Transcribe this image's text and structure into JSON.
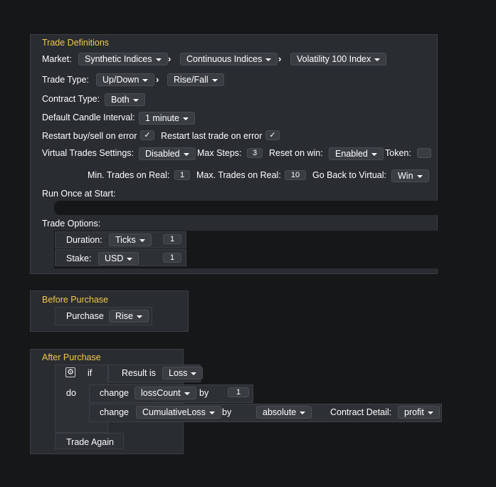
{
  "trade_definitions": {
    "title": "Trade Definitions",
    "market": {
      "label": "Market:",
      "options": [
        "Synthetic Indices",
        "Continuous Indices",
        "Volatility 100 Index"
      ]
    },
    "trade_type": {
      "label": "Trade Type:",
      "options": [
        "Up/Down",
        "Rise/Fall"
      ]
    },
    "contract_type": {
      "label": "Contract Type:",
      "value": "Both"
    },
    "candle": {
      "label": "Default Candle Interval:",
      "value": "1 minute"
    },
    "restart_buy_sell": {
      "label": "Restart buy/sell on error",
      "checked": "✓"
    },
    "restart_last": {
      "label": "Restart last trade on error",
      "checked": "✓"
    },
    "virtual": {
      "label": "Virtual Trades Settings:",
      "value": "Disabled",
      "max_steps_label": "Max Steps:",
      "max_steps": "3",
      "reset_label": "Reset on win:",
      "reset_value": "Enabled",
      "token_label": "Token:",
      "min_real_label": "Min. Trades on Real:",
      "min_real": "1",
      "max_real_label": "Max. Trades on Real:",
      "max_real": "10",
      "go_back_label": "Go Back to Virtual:",
      "go_back_value": "Win"
    },
    "run_once_label": "Run Once at Start:",
    "trade_options_label": "Trade Options:",
    "duration": {
      "label": "Duration:",
      "unit": "Ticks",
      "value": "1"
    },
    "stake": {
      "label": "Stake:",
      "currency": "USD",
      "value": "1"
    }
  },
  "before_purchase": {
    "title": "Before Purchase",
    "purchase_label": "Purchase",
    "purchase_value": "Rise"
  },
  "after_purchase": {
    "title": "After Purchase",
    "if_label": "if",
    "do_label": "do",
    "gear_icon": "⚙",
    "result_label": "Result is",
    "result_value": "Loss",
    "change1": {
      "label": "change",
      "var": "lossCount",
      "by": "by",
      "value": "1"
    },
    "change2": {
      "label": "change",
      "var": "CumulativeLoss",
      "by": "by",
      "func": "absolute",
      "detail_label": "Contract Detail:",
      "detail_value": "profit"
    },
    "trade_again": "Trade Again"
  },
  "colors": {
    "header": "#f2c94c",
    "background": "#151719",
    "block": "#292c30"
  }
}
